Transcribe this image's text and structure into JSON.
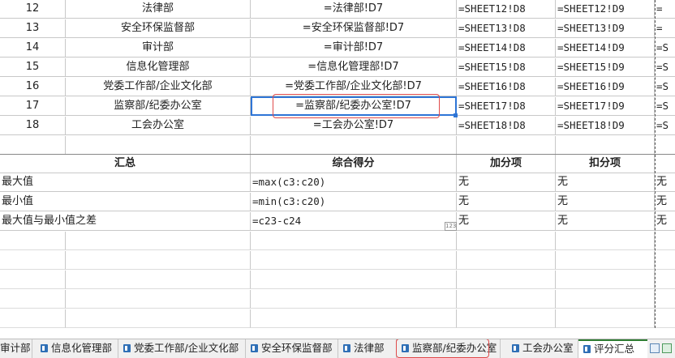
{
  "rows": [
    {
      "num": "12",
      "dept": "法律部",
      "formula": "=法律部!D7",
      "d": "=SHEET12!D8",
      "e": "=SHEET12!D9",
      "f": "="
    },
    {
      "num": "13",
      "dept": "安全环保监督部",
      "formula": "=安全环保监督部!D7",
      "d": "=SHEET13!D8",
      "e": "=SHEET13!D9",
      "f": "="
    },
    {
      "num": "14",
      "dept": "审计部",
      "formula": "=审计部!D7",
      "d": "=SHEET14!D8",
      "e": "=SHEET14!D9",
      "f": "=S"
    },
    {
      "num": "15",
      "dept": "信息化管理部",
      "formula": "=信息化管理部!D7",
      "d": "=SHEET15!D8",
      "e": "=SHEET15!D9",
      "f": "=S"
    },
    {
      "num": "16",
      "dept": "党委工作部/企业文化部",
      "formula": "=党委工作部/企业文化部!D7",
      "d": "=SHEET16!D8",
      "e": "=SHEET16!D9",
      "f": "=S"
    },
    {
      "num": "17",
      "dept": "监察部/纪委办公室",
      "formula": "=监察部/纪委办公室!D7",
      "d": "=SHEET17!D8",
      "e": "=SHEET17!D9",
      "f": "=S"
    },
    {
      "num": "18",
      "dept": "工会办公室",
      "formula": "=工会办公室!D7",
      "d": "=SHEET18!D8",
      "e": "=SHEET18!D9",
      "f": "=S"
    }
  ],
  "summary_header": {
    "label": "汇总",
    "score": "综合得分",
    "plus": "加分项",
    "minus": "扣分项"
  },
  "summary_rows": [
    {
      "label": "最大值",
      "formula": "=max(c3:c20)",
      "plus": "无",
      "minus": "无",
      "f": "无"
    },
    {
      "label": "最小值",
      "formula": "=min(c3:c20)",
      "plus": "无",
      "minus": "无",
      "f": "无"
    },
    {
      "label": "最大值与最小值之差",
      "formula": "=c23-c24",
      "plus": "无",
      "minus": "无",
      "f": "无"
    }
  ],
  "small_tag": "123",
  "tabs": [
    {
      "label": "审计部",
      "icon": "sheet-icon"
    },
    {
      "label": "信息化管理部",
      "icon": "sheet-icon"
    },
    {
      "label": "党委工作部/企业文化部",
      "icon": "sheet-icon"
    },
    {
      "label": "安全环保监督部",
      "icon": "sheet-icon"
    },
    {
      "label": "法律部",
      "icon": "sheet-icon"
    },
    {
      "label": "监察部/纪委办公室",
      "icon": "sheet-icon"
    },
    {
      "label": "工会办公室",
      "icon": "sheet-icon"
    },
    {
      "label": "评分汇总",
      "icon": "sheet-icon"
    }
  ],
  "colors": {
    "selection": "#2e75d6",
    "annotation": "#e04b4b",
    "active_tab": "#2e7d32",
    "tab_icon": "#2f6fb6"
  }
}
